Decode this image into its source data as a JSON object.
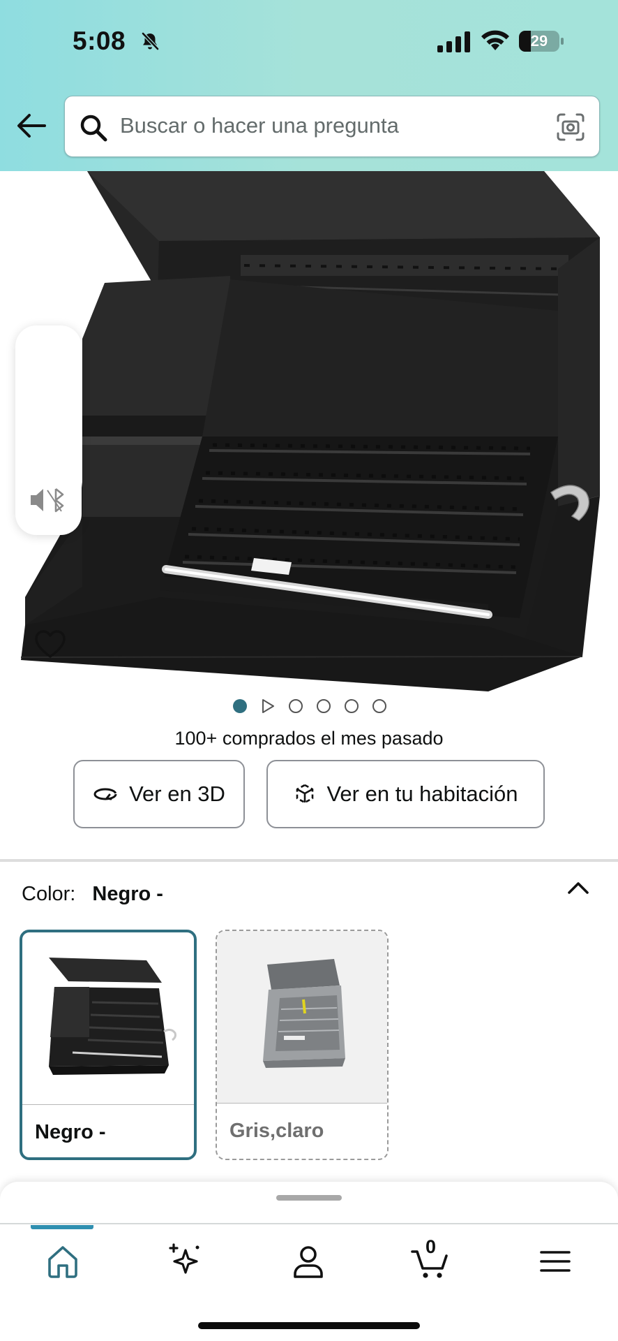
{
  "status_bar": {
    "time": "5:08",
    "battery_level": "29",
    "battery_fraction": 0.29,
    "icons": [
      "bell-slash-icon",
      "cellular-signal-icon",
      "wifi-icon",
      "battery-icon"
    ]
  },
  "header": {
    "back_icon": "arrow-left-icon",
    "search": {
      "placeholder": "Buscar o hacer una pregunta",
      "search_icon": "magnifier-icon",
      "camera_icon": "camera-scan-icon"
    }
  },
  "product": {
    "image_icon": "tool-chest-image",
    "carousel": {
      "count": 6,
      "active_index": 0,
      "video_index": 1
    },
    "bought_text": "100+ comprados el mes pasado",
    "view_3d_label": "Ver en 3D",
    "view_room_label": "Ver en tu habitación"
  },
  "color_selector": {
    "label": "Color:",
    "selected_value": "Negro -",
    "options": [
      {
        "name": "Negro -",
        "selected": true,
        "swatch_color": "#1c1c1c"
      },
      {
        "name": "Gris,claro",
        "selected": false,
        "swatch_color": "#9da0a3"
      }
    ]
  },
  "bottom_nav": {
    "items": [
      "home-icon",
      "sparkle-icon",
      "account-icon",
      "cart-icon",
      "menu-icon"
    ],
    "active_index": 0,
    "cart_count": "0"
  },
  "colors": {
    "accent": "#2f6f80",
    "header_gradient_start": "#8fdde0",
    "header_gradient_end": "#a4e3da",
    "nav_active": "#2f8fb0"
  }
}
